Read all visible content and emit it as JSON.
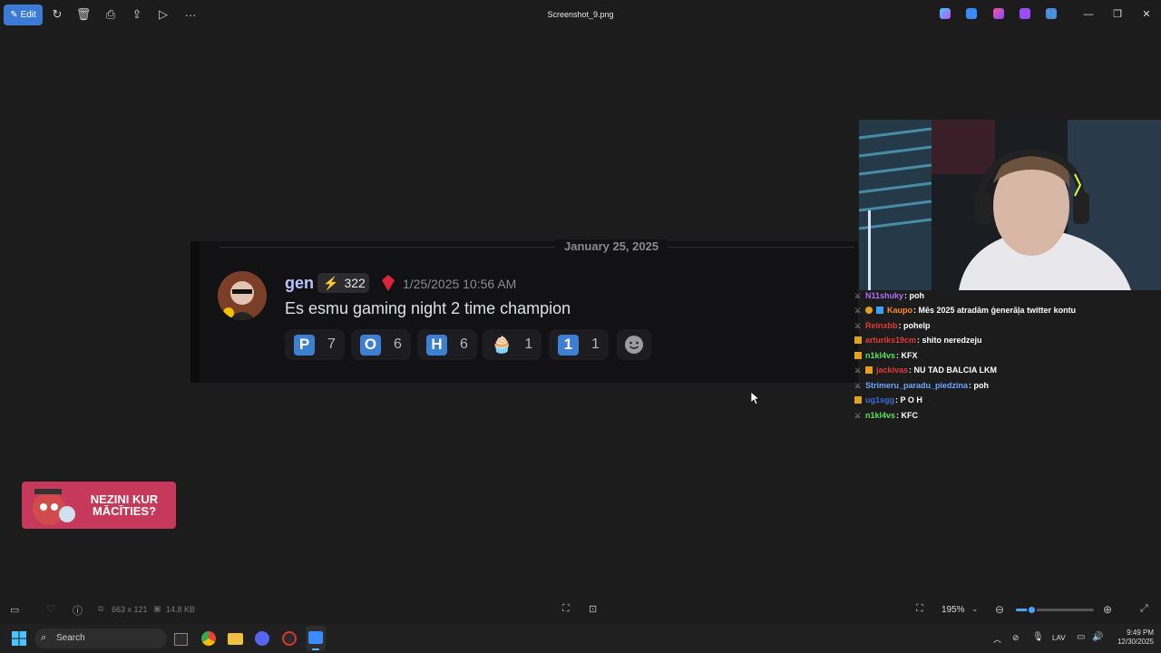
{
  "titlebar": {
    "edit_label": "Edit",
    "file_name": "Screenshot_9.png"
  },
  "discord": {
    "date_divider": "January 25, 2025",
    "username": "gen",
    "boost_count": "322",
    "timestamp": "1/25/2025 10:56 AM",
    "message": "Es esmu gaming night 2 time champion",
    "reactions": [
      {
        "glyph": "P",
        "count": "7"
      },
      {
        "glyph": "O",
        "count": "6"
      },
      {
        "glyph": "H",
        "count": "6"
      },
      {
        "glyph": "🧁",
        "count": "1"
      },
      {
        "glyph": "1",
        "count": "1"
      }
    ]
  },
  "chat": [
    {
      "user": "N11shuky",
      "text": ": poh",
      "color": "#b070ff"
    },
    {
      "user": "Kaupo",
      "text": ": Mēs 2025 atradām ģenerāļa twitter kontu",
      "color": "#ff8c2a"
    },
    {
      "user": "Reinxbb",
      "text": ": pohelp",
      "color": "#e23a3a"
    },
    {
      "user": "arturiks19cm",
      "text": ": shito neredzeju",
      "color": "#e23a3a"
    },
    {
      "user": "n1kl4vs",
      "text": ": KFX",
      "color": "#5be35b"
    },
    {
      "user": "jackivas",
      "text": ": NU TAD BALCIA LKM",
      "color": "#e23a3a"
    },
    {
      "user": "Strimeru_paradu_piedzina",
      "text": ": poh",
      "color": "#6ea7ff"
    },
    {
      "user": "ug1sgg",
      "text": ": P O H",
      "color": "#3a6bd9"
    },
    {
      "user": "n1kl4vs",
      "text": ": KFC",
      "color": "#5be35b"
    }
  ],
  "promo": {
    "line1": "NEZINI KUR",
    "line2": "MĀCĪTIES?"
  },
  "statusbar": {
    "dimensions": "663 x 121",
    "file_size": "14.8 KB",
    "zoom": "195%",
    "zoom_fraction": 0.2
  },
  "taskbar": {
    "search_placeholder": "Search",
    "language": "LAV",
    "time": "9:49 PM",
    "date": "12/30/2025"
  }
}
